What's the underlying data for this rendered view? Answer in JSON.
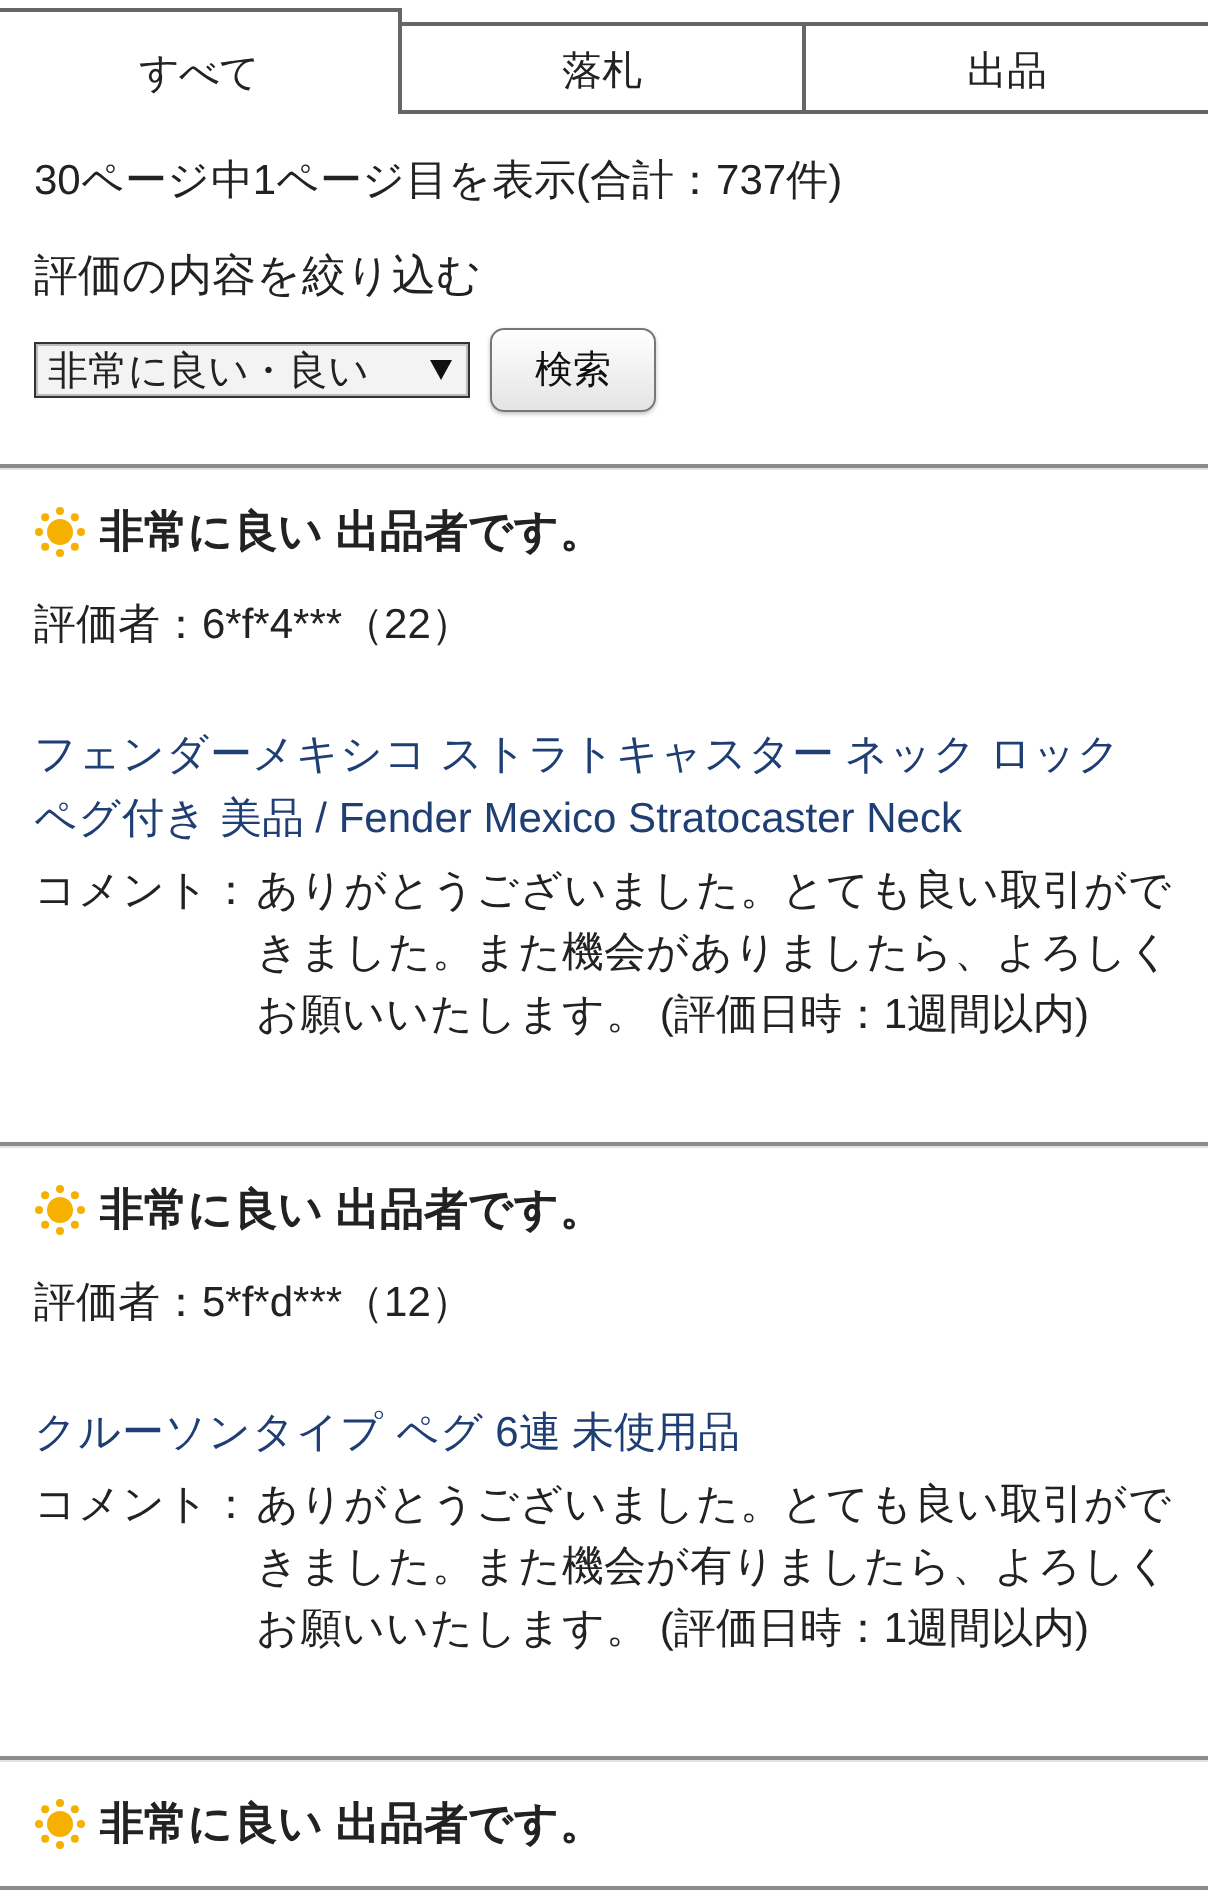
{
  "tabs": [
    {
      "label": "すべて",
      "selected": true
    },
    {
      "label": "落札",
      "selected": false
    },
    {
      "label": "出品",
      "selected": false
    }
  ],
  "summary": "30ページ中1ページ目を表示(合計：737件)",
  "filter": {
    "label": "評価の内容を絞り込む",
    "select_value": "非常に良い・良い",
    "button": "検索"
  },
  "reviews": [
    {
      "kind": "very_good",
      "title": "非常に良い 出品者です。",
      "rater": "評価者：6*f*4***（22）",
      "item": "フェンダーメキシコ ストラトキャスター ネック ロックペグ付き 美品 / Fender Mexico Stratocaster Neck",
      "comment_label": "コメント：",
      "comment": "ありがとうございました。とても良い取引ができました。また機会がありましたら、よろしくお願いいたします。 (評価日時：1週間以内)"
    },
    {
      "kind": "very_good",
      "title": "非常に良い 出品者です。",
      "rater": "評価者：5*f*d***（12）",
      "item": "クルーソンタイプ ペグ 6連 未使用品",
      "comment_label": "コメント：",
      "comment": "ありがとうございました。とても良い取引ができました。また機会が有りましたら、よろしくお願いいたします。 (評価日時：1週間以内)"
    },
    {
      "kind": "very_good",
      "title": "非常に良い 出品者です。"
    }
  ]
}
